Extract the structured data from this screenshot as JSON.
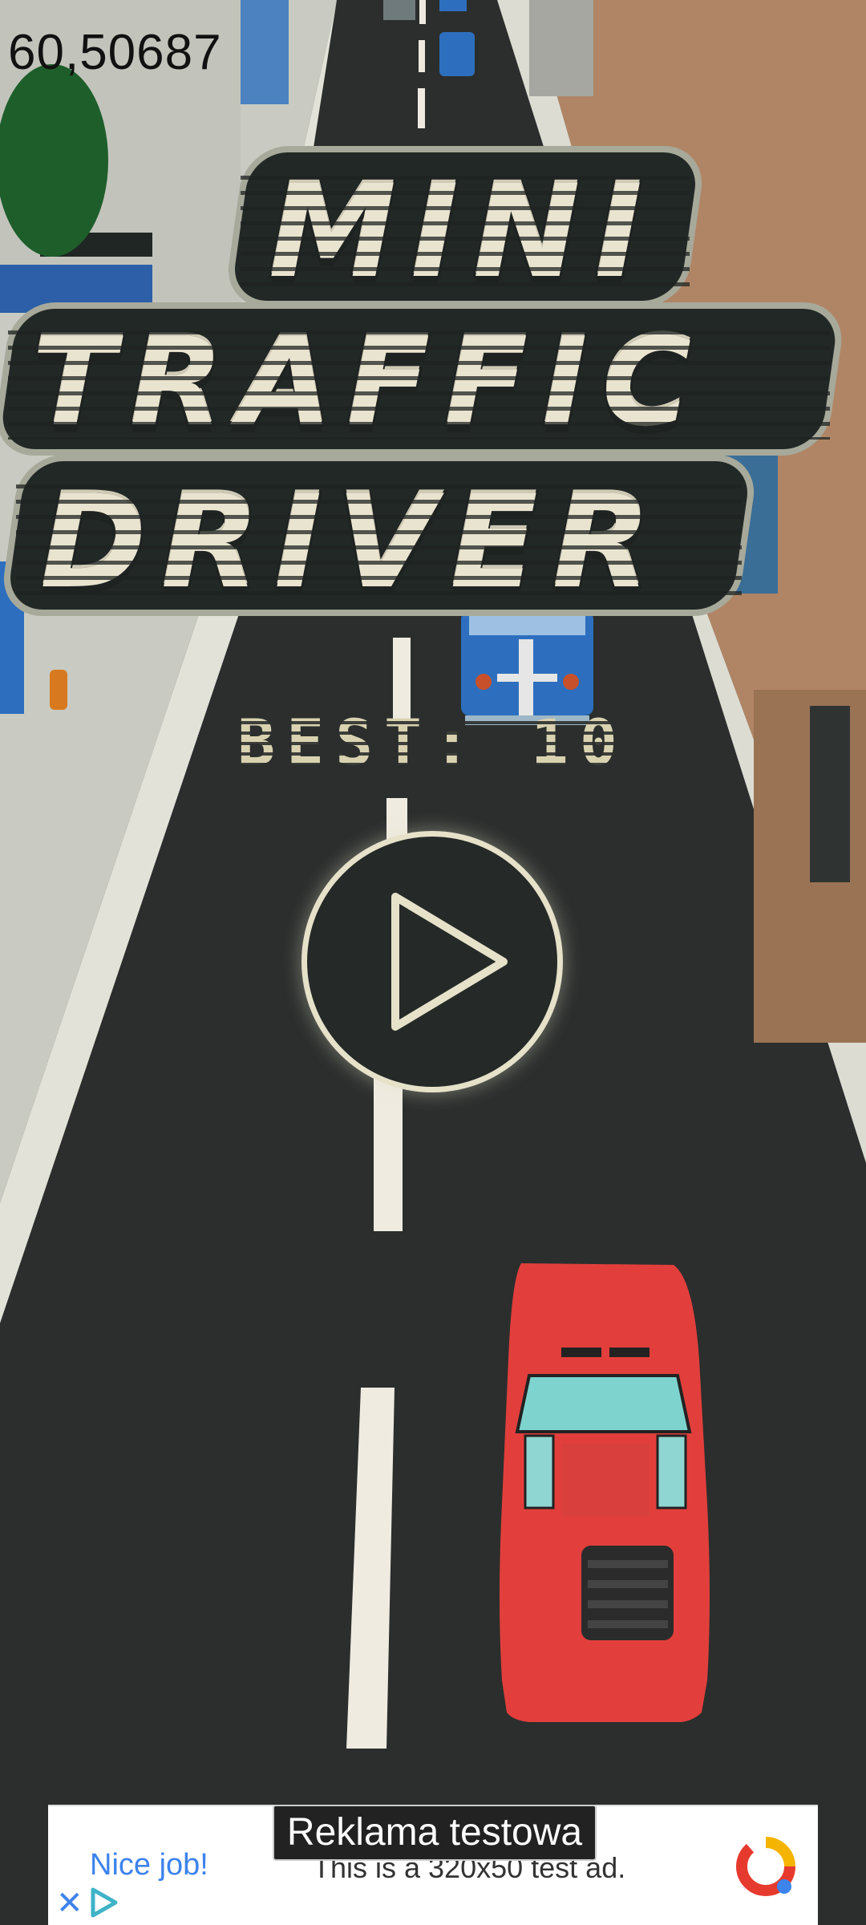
{
  "hud": {
    "fps_readout": "60,50687"
  },
  "title": {
    "line1": "MINI",
    "line2": "TRAFFIC",
    "line3": "DRIVER"
  },
  "best": {
    "label": "BEST: 10"
  },
  "play": {
    "icon": "play-icon"
  },
  "ad": {
    "label": "Reklama testowa",
    "headline": "Nice job!",
    "text": "This is a 320x50 test ad.",
    "close_icon": "close-icon",
    "adchoices_icon": "adchoices-icon",
    "logo_icon": "ad-network-logo-icon"
  },
  "colors": {
    "road": "#2b2e2d",
    "sidewalk": "#d8d8cc",
    "player_car": "#e23f3c",
    "traffic_car": "#2d6fbe",
    "title_fill": "#e9e4cf"
  }
}
